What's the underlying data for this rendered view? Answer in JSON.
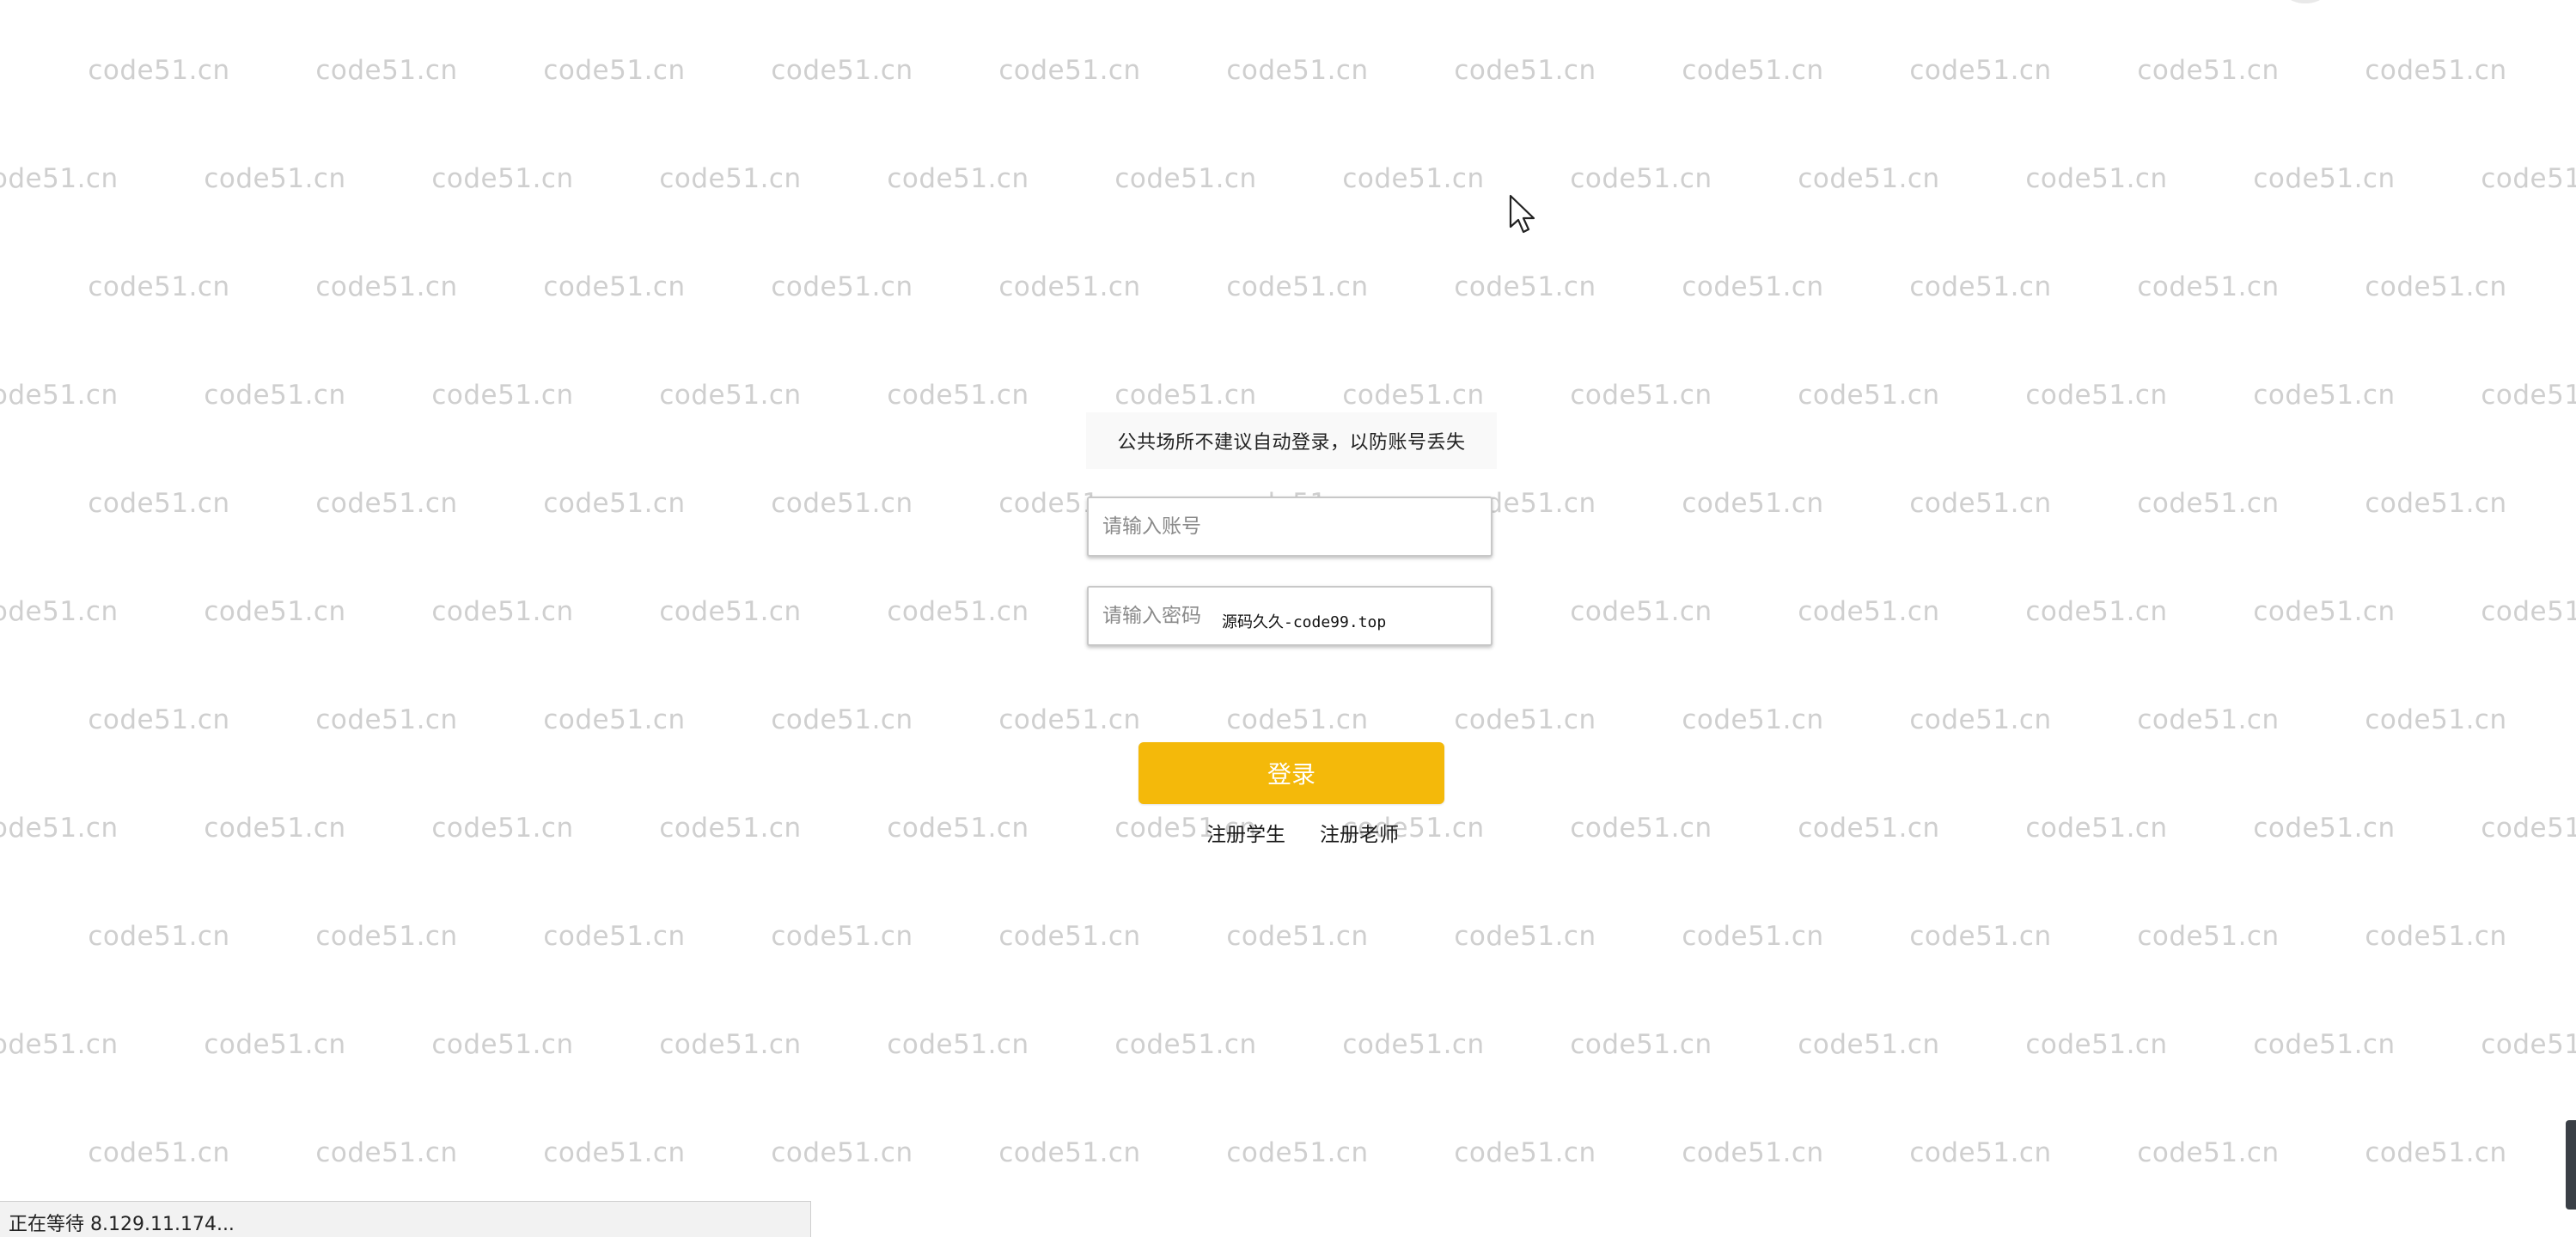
{
  "watermark": {
    "text": "code51.cn"
  },
  "login": {
    "notice": "公共场所不建议自动登录，以防账号丢失",
    "account_placeholder": "请输入账号",
    "password_placeholder": "请输入密码",
    "password_overlay_text": "源码久久-code99.top",
    "login_button_label": "登录",
    "register_student_label": "注册学生",
    "register_teacher_label": "注册老师"
  },
  "status_bar": {
    "text": "正在等待 8.129.11.174..."
  },
  "colors": {
    "login_button": "#f4b90a",
    "watermark": "#cfcfcf",
    "notice_background": "#f9f9f9"
  }
}
